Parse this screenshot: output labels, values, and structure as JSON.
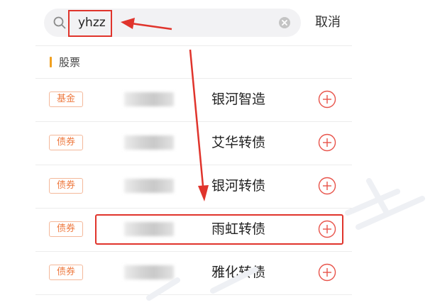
{
  "search": {
    "query": "yhzz",
    "cancel_label": "取消"
  },
  "section": {
    "title": "股票"
  },
  "results": [
    {
      "badge": "基金",
      "name": "银河智造"
    },
    {
      "badge": "债券",
      "name": "艾华转债"
    },
    {
      "badge": "债券",
      "name": "银河转债"
    },
    {
      "badge": "债券",
      "name": "雨虹转债"
    },
    {
      "badge": "债券",
      "name": "雅化转债"
    }
  ],
  "icons": {
    "search": "search-icon",
    "clear": "clear-icon",
    "add": "add-circle-icon"
  },
  "colors": {
    "accent_orange": "#f0a020",
    "badge_text": "#ee7a40",
    "badge_border": "#f4b89a",
    "add_icon": "#e8534a",
    "annotation_red": "#e0342c",
    "search_bg": "#f2f2f4"
  }
}
